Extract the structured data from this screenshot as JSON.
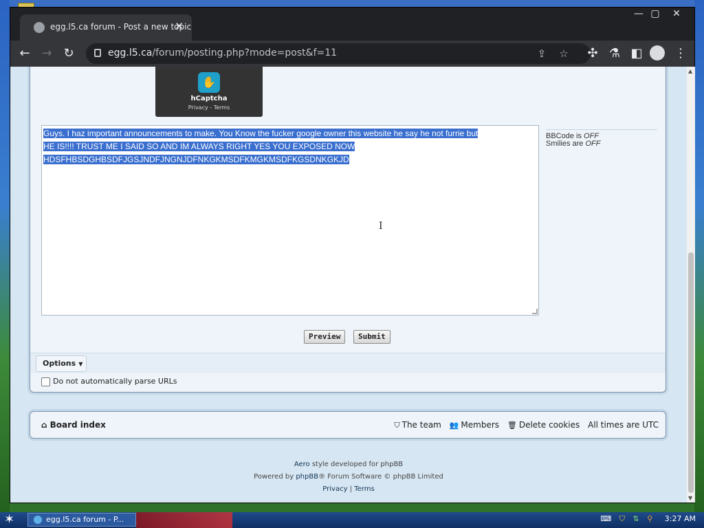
{
  "browser": {
    "tab_title": "egg.l5.ca forum - Post a new topic",
    "tab_close": "✕",
    "url_host": "egg.l5.ca",
    "url_path": "/forum/posting.php?mode=post&f=11",
    "window_min": "—",
    "window_max": "▢",
    "window_close": "✕",
    "icons": [
      "back-icon",
      "forward-icon",
      "reload-icon",
      "lock-icon",
      "share-icon",
      "star-icon",
      "extensions-icon",
      "lab-icon",
      "sidebar-icon",
      "profile-icon",
      "menu-icon"
    ]
  },
  "captcha": {
    "name": "hCaptcha",
    "links": "Privacy - Terms"
  },
  "editor": {
    "lines": [
      "Guys. I haz important announcements to make. You Know the fucker google owner this website he say he not furrie but",
      "HE IS!!!! TRUST ME I SAID SO AND IM ALWAYS RIGHT YES YOU EXPOSED NOW",
      "HDSFHBSDGHBSDFJGSJNDFJNGNJDFNKGKMSDFKMGKMSDFKGSDNKGKJD"
    ]
  },
  "bbinfo": {
    "bbcode_label": "BBCode is",
    "bbcode_state": "OFF",
    "smilies_label": "Smilies are",
    "smilies_state": "OFF"
  },
  "buttons": {
    "preview": "Preview",
    "submit": "Submit"
  },
  "options": {
    "label": "Options",
    "parse_urls_label": "Do not automatically parse URLs"
  },
  "nav": {
    "board_index": "Board index",
    "team": "The team",
    "members": "Members",
    "delete_cookies": "Delete cookies",
    "timezone": "All times are UTC"
  },
  "footer": {
    "style_prefix": "Aero",
    "style_suffix": "style developed for phpBB",
    "powered_prefix": "Powered by",
    "powered_link": "phpBB",
    "powered_suffix": "® Forum Software © phpBB Limited",
    "privacy": "Privacy",
    "sep": "|",
    "terms": "Terms"
  },
  "taskbar": {
    "task_label": "egg.l5.ca forum - P...",
    "clock": "3:27 AM"
  }
}
